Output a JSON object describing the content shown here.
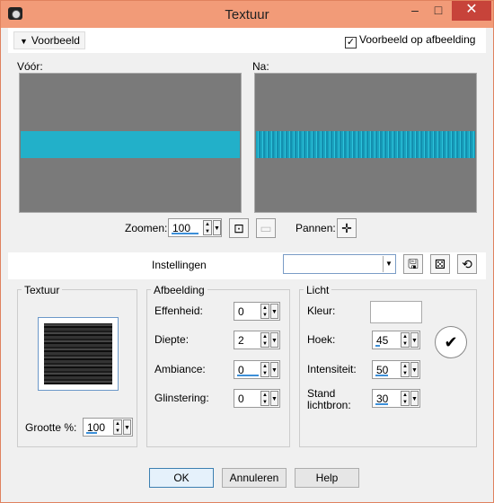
{
  "window": {
    "title": "Textuur",
    "min_glyph": "–",
    "max_glyph": "□",
    "close_glyph": "✕"
  },
  "colors": {
    "titlebar": "#f29b78",
    "close": "#c7433a",
    "preview_gray": "#7a7a7a",
    "texture_band": "#22b0c9"
  },
  "preview": {
    "toggle_label": "Voorbeeld",
    "overlay_label": "Voorbeeld op afbeelding",
    "overlay_checked": true,
    "before_label": "Vóór:",
    "after_label": "Na:"
  },
  "zoom": {
    "label": "Zoomen:",
    "value": "100",
    "pan_label": "Pannen:",
    "icons": [
      "fit-icon",
      "actual-size-icon",
      "pan-icon"
    ]
  },
  "settings": {
    "label": "Instellingen",
    "value": "",
    "icons": [
      "save-icon",
      "random-icon",
      "reset-icon"
    ]
  },
  "texture": {
    "title": "Textuur",
    "size_label": "Grootte %:",
    "size_value": "100"
  },
  "image": {
    "title": "Afbeelding",
    "smoothness_label": "Effenheid:",
    "smoothness_value": "0",
    "depth_label": "Diepte:",
    "depth_value": "2",
    "ambiance_label": "Ambiance:",
    "ambiance_value": "0",
    "shininess_label": "Glinstering:",
    "shininess_value": "0"
  },
  "light": {
    "title": "Licht",
    "color_label": "Kleur:",
    "color_value": "#ffffff",
    "angle_label": "Hoek:",
    "angle_value": "45",
    "intensity_label": "Intensiteit:",
    "intensity_value": "50",
    "elevation_label": "Stand lichtbron:",
    "elevation_value": "30"
  },
  "buttons": {
    "ok": "OK",
    "cancel": "Annuleren",
    "help": "Help"
  }
}
